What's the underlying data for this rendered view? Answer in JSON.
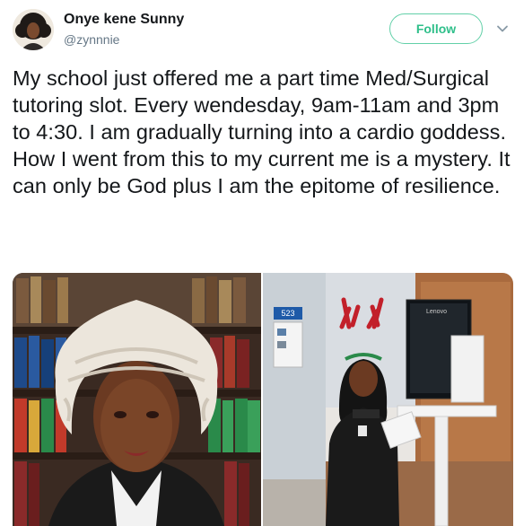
{
  "author": {
    "display_name": "Onye kene Sunny",
    "handle": "@zynnnie"
  },
  "actions": {
    "follow_label": "Follow",
    "menu_icon": "chevron-down-icon"
  },
  "tweet": {
    "text": "My school just offered me a part time Med/Surgical tutoring slot. Every wendesday, 9am-11am and 3pm to 4:30. I am gradually turning into a cardio goddess. How I went from this to my current me is a mystery. It can only be God plus I am the epitome of resilience."
  },
  "media": {
    "right_photo": {
      "room_sign": "523",
      "monitor_brand": "Lenovo"
    }
  },
  "colors": {
    "follow_accent": "#2fbf8a",
    "handle_gray": "#657786",
    "text": "#14171a"
  }
}
